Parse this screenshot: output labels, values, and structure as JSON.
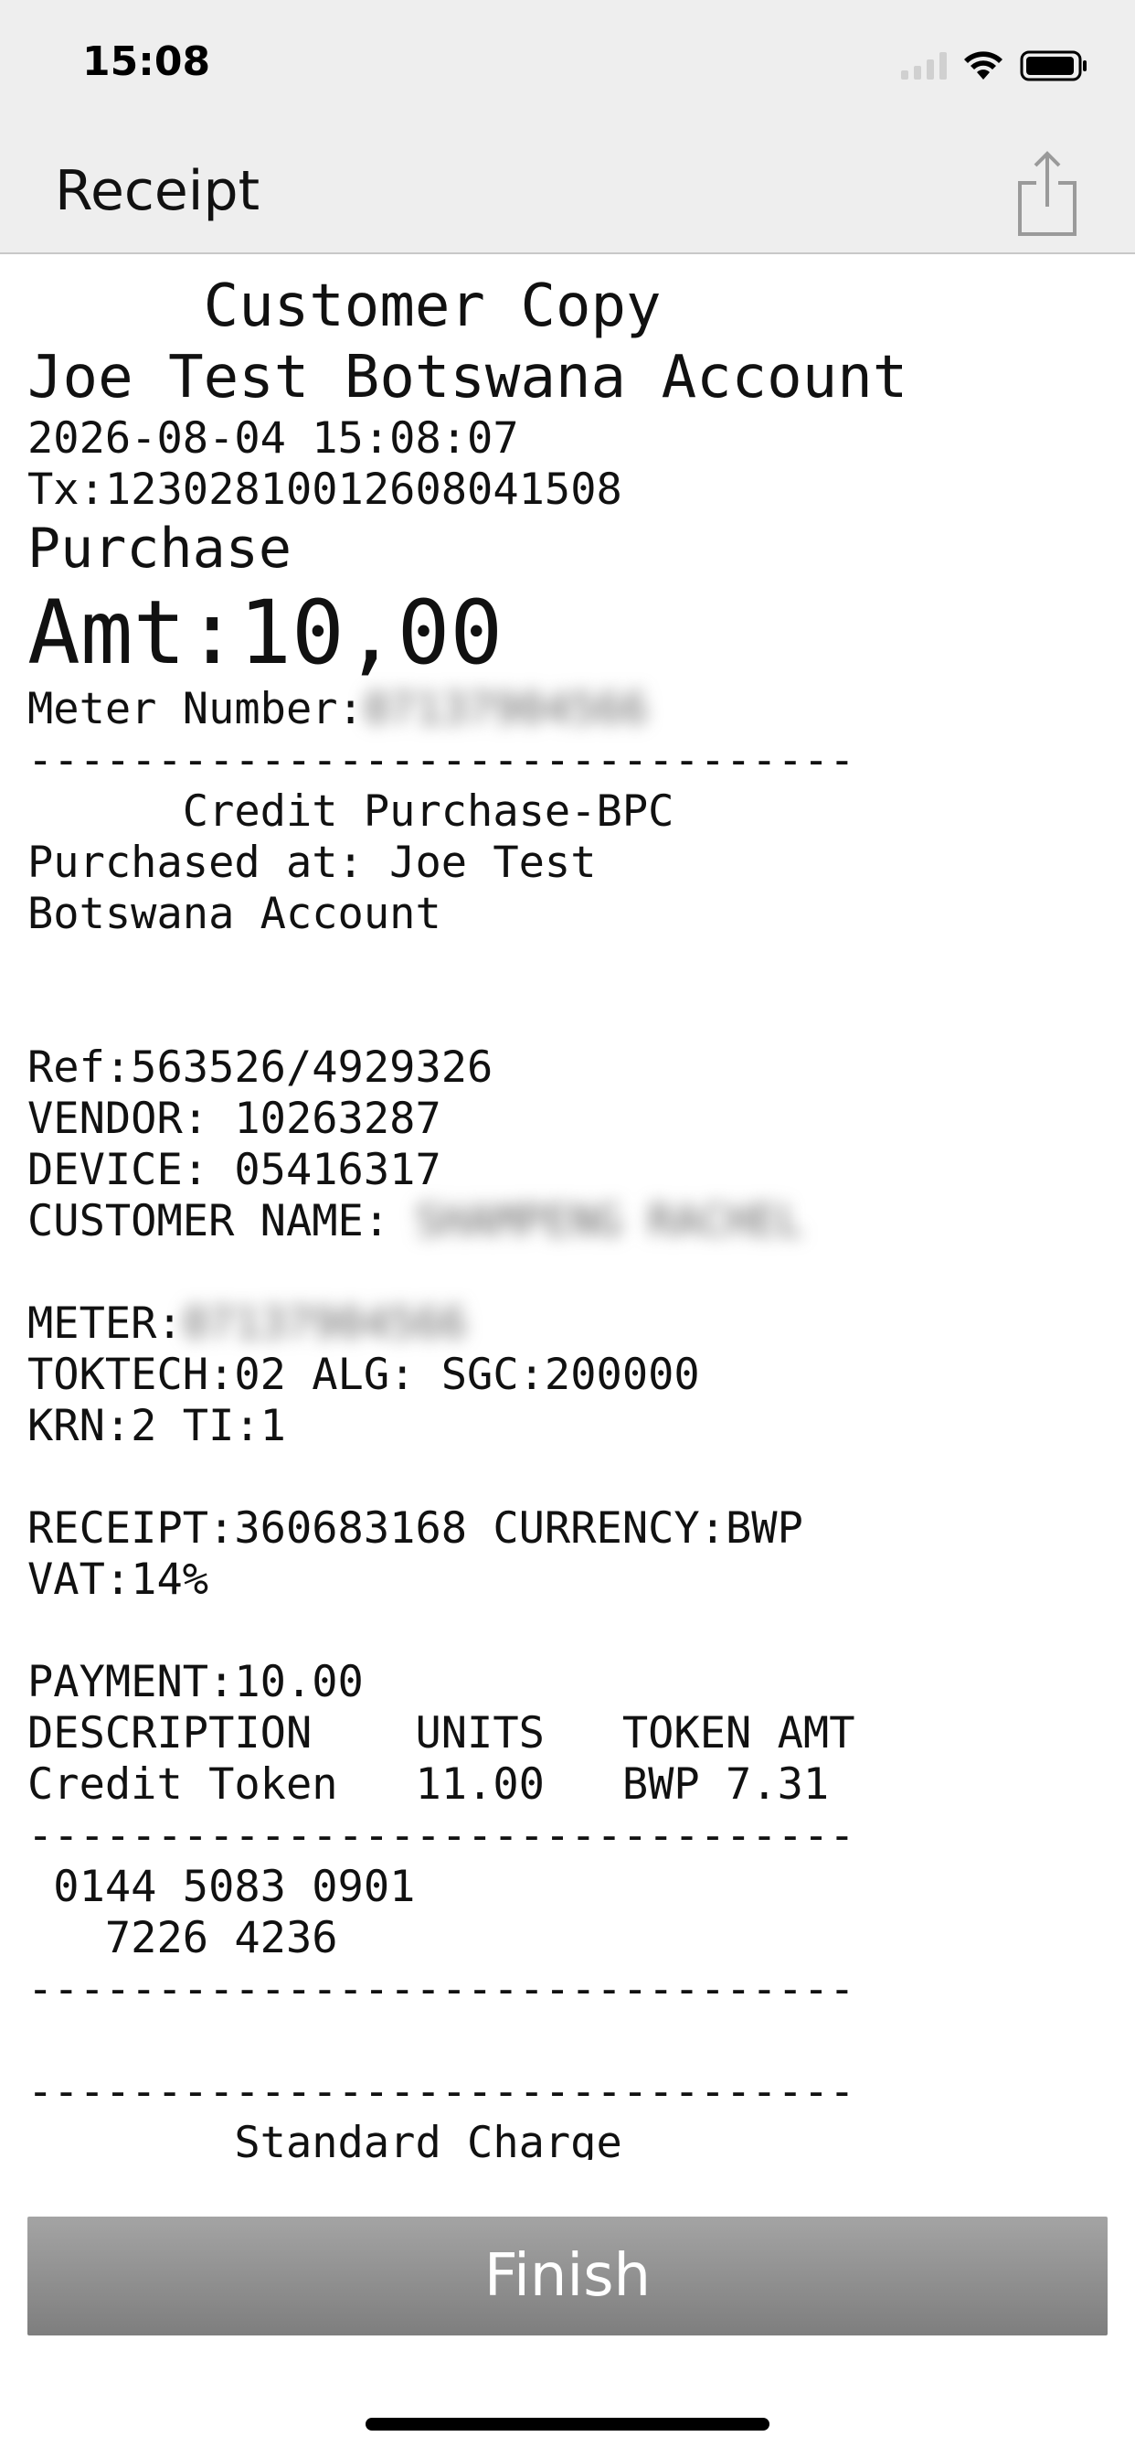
{
  "status_bar": {
    "time": "15:08",
    "icons": [
      "signal-icon",
      "wifi-icon",
      "battery-icon"
    ]
  },
  "nav": {
    "title": "Receipt",
    "share_icon": "share-icon"
  },
  "receipt": {
    "lines": [
      {
        "text": "     Customer Copy",
        "style": "title"
      },
      {
        "text": "Joe Test Botswana Account",
        "style": "title"
      },
      {
        "text": "2026-08-04 15:08:07",
        "style": "normal"
      },
      {
        "text": "Tx:12302810012608041508",
        "style": "normal"
      },
      {
        "text": "Purchase",
        "style": "big"
      },
      {
        "text": "Amt:10,00",
        "style": "amt"
      },
      {
        "text": "Meter Number:",
        "blurred": "07137904566",
        "style": "normal"
      },
      {
        "text": "--------------------------------",
        "style": "normal"
      },
      {
        "text": "      Credit Purchase-BPC",
        "style": "normal"
      },
      {
        "text": "Purchased at: Joe Test",
        "style": "normal"
      },
      {
        "text": "Botswana Account",
        "style": "normal"
      },
      {
        "text": "",
        "style": "blank"
      },
      {
        "text": "",
        "style": "blank"
      },
      {
        "text": "Ref:563526/4929326",
        "style": "normal"
      },
      {
        "text": "VENDOR: 10263287",
        "style": "normal"
      },
      {
        "text": "DEVICE: 05416317",
        "style": "normal"
      },
      {
        "text": "CUSTOMER NAME: ",
        "blurred": "SHAMPENG RACHEL",
        "style": "normal"
      },
      {
        "text": "",
        "style": "blank"
      },
      {
        "text": "METER:",
        "blurred": "07137904566",
        "style": "normal"
      },
      {
        "text": "TOKTECH:02 ALG: SGC:200000",
        "style": "normal"
      },
      {
        "text": "KRN:2 TI:1",
        "style": "normal"
      },
      {
        "text": "",
        "style": "blank"
      },
      {
        "text": "RECEIPT:360683168 CURRENCY:BWP",
        "style": "normal"
      },
      {
        "text": "VAT:14%",
        "style": "normal"
      },
      {
        "text": "",
        "style": "blank"
      },
      {
        "text": "PAYMENT:10.00",
        "style": "normal"
      },
      {
        "text": "DESCRIPTION    UNITS   TOKEN AMT",
        "style": "normal"
      },
      {
        "text": "Credit Token   11.00   BWP 7.31",
        "style": "normal"
      },
      {
        "text": "--------------------------------",
        "style": "normal"
      },
      {
        "text": " 0144 5083 0901",
        "style": "normal"
      },
      {
        "text": "   7226 4236",
        "style": "normal"
      },
      {
        "text": "--------------------------------",
        "style": "normal"
      },
      {
        "text": "",
        "style": "blank"
      },
      {
        "text": "--------------------------------",
        "style": "normal"
      },
      {
        "text": "        Standard Charge",
        "style": "normal"
      }
    ]
  },
  "actions": {
    "finish_label": "Finish"
  }
}
